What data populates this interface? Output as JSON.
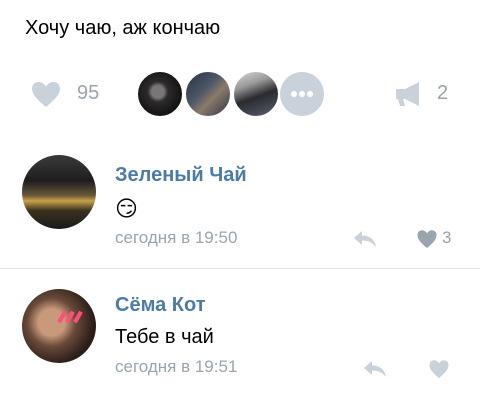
{
  "post": {
    "text": "Хочу чаю, аж кончаю",
    "likes_count": "95",
    "shares_count": "2",
    "icons": {
      "like": "heart-icon",
      "share": "megaphone-icon",
      "more": "more-dots-icon"
    }
  },
  "comments": [
    {
      "author": "Зеленый Чай",
      "emoji": "😏",
      "timestamp": "сегодня в 19:50",
      "likes": "3"
    },
    {
      "author": "Сёма Кот",
      "text": "Тебе в чай",
      "timestamp": "сегодня в 19:51",
      "likes": ""
    }
  ],
  "colors": {
    "name": "#4c7ba8",
    "meta": "#9aa4ae",
    "icon": "#c9d1da"
  }
}
